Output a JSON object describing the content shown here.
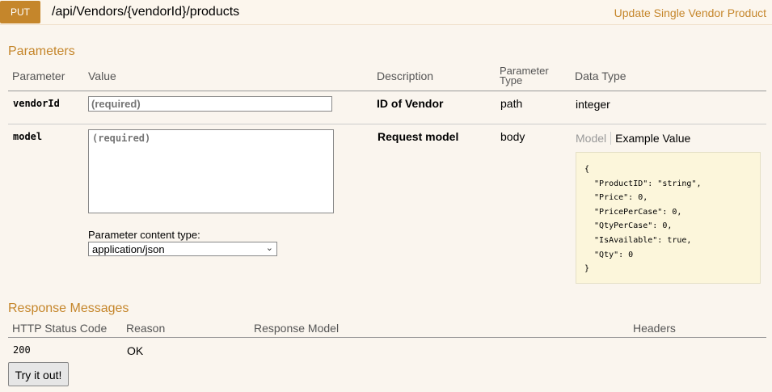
{
  "header": {
    "method": "PUT",
    "path": "/api/Vendors/{vendorId}/products",
    "summary": "Update Single Vendor Product"
  },
  "parameters": {
    "title": "Parameters",
    "columns": {
      "parameter": "Parameter",
      "value": "Value",
      "description": "Description",
      "parameter_type_line1": "Parameter",
      "parameter_type_line2": "Type",
      "data_type": "Data Type"
    },
    "rows": [
      {
        "name": "vendorId",
        "placeholder": "(required)",
        "description": "ID of Vendor",
        "param_type": "path",
        "data_type": "integer"
      },
      {
        "name": "model",
        "placeholder": "(required)",
        "description": "Request model",
        "param_type": "body",
        "content_type_label": "Parameter content type:",
        "content_type_value": "application/json",
        "tab_model": "Model",
        "tab_example": "Example Value",
        "example_value": "{\n  \"ProductID\": \"string\",\n  \"Price\": 0,\n  \"PricePerCase\": 0,\n  \"QtyPerCase\": 0,\n  \"IsAvailable\": true,\n  \"Qty\": 0\n}"
      }
    ]
  },
  "responses": {
    "title": "Response Messages",
    "columns": {
      "status": "HTTP Status Code",
      "reason": "Reason",
      "model": "Response Model",
      "headers": "Headers"
    },
    "rows": [
      {
        "status": "200",
        "reason": "OK"
      }
    ]
  },
  "try_button": "Try it out!"
}
